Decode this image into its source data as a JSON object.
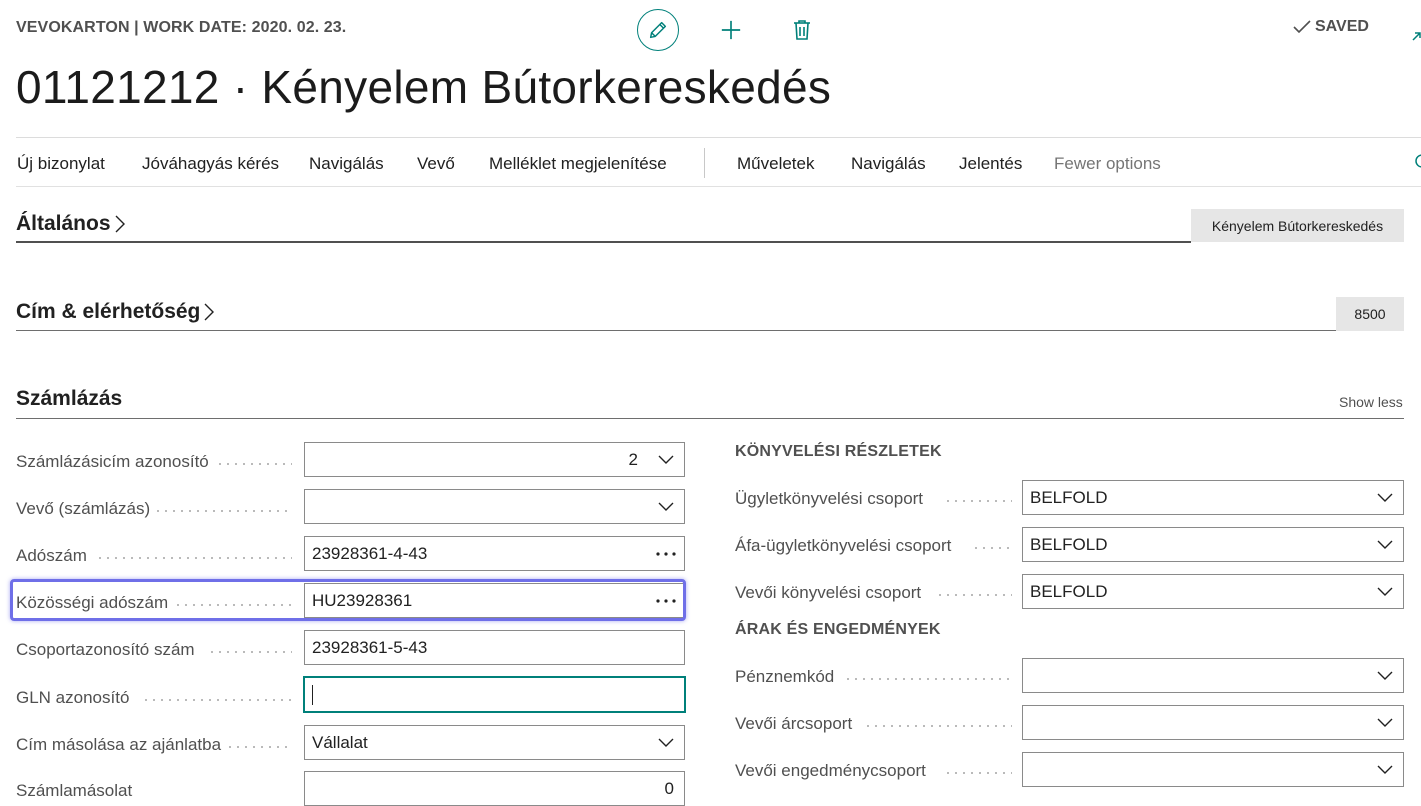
{
  "header": {
    "context": "VEVOKARTON | WORK DATE: 2020. 02. 23.",
    "saved": "SAVED",
    "title": "01121212 · Kényelem Bútorkereskedés"
  },
  "actions": {
    "primary": [
      "Új bizonylat",
      "Jóváhagyás kérés",
      "Navigálás",
      "Vevő",
      "Melléklet megjelenítése"
    ],
    "secondary": [
      "Műveletek",
      "Navigálás",
      "Jelentés"
    ],
    "fewer": "Fewer options"
  },
  "fasttabs": {
    "general": {
      "title": "Általános",
      "summary": "Kényelem Bútorkereskedés"
    },
    "address": {
      "title": "Cím & elérhetőség",
      "summary": "8500"
    },
    "invoicing": {
      "title": "Számlázás",
      "show_less": "Show less"
    }
  },
  "left_fields": [
    {
      "label": "Számlázásicím azonosító",
      "value": "2"
    },
    {
      "label": "Vevő (számlázás)",
      "value": ""
    },
    {
      "label": "Adószám",
      "value": "23928361-4-43"
    },
    {
      "label": "Közösségi adószám",
      "value": "HU23928361"
    },
    {
      "label": "Csoportazonosító szám",
      "value": "23928361-5-43"
    },
    {
      "label": "GLN azonosító",
      "value": ""
    },
    {
      "label": "Cím másolása az ajánlatba",
      "value": "Vállalat"
    },
    {
      "label": "Számlamásolat",
      "value": "0"
    }
  ],
  "posting": {
    "title": "KÖNYVELÉSI RÉSZLETEK",
    "fields": [
      {
        "label": "Ügyletkönyvelési csoport",
        "value": "BELFOLD"
      },
      {
        "label": "Áfa-ügyletkönyvelési csoport",
        "value": "BELFOLD"
      },
      {
        "label": "Vevői könyvelési csoport",
        "value": "BELFOLD"
      }
    ]
  },
  "prices": {
    "title": "ÁRAK ÉS ENGEDMÉNYEK",
    "fields": [
      {
        "label": "Pénznemkód",
        "value": ""
      },
      {
        "label": "Vevői árcsoport",
        "value": ""
      },
      {
        "label": "Vevői engedménycsoport",
        "value": ""
      }
    ]
  },
  "colors": {
    "accent": "#00807a",
    "highlight": "#6f6fe8"
  }
}
